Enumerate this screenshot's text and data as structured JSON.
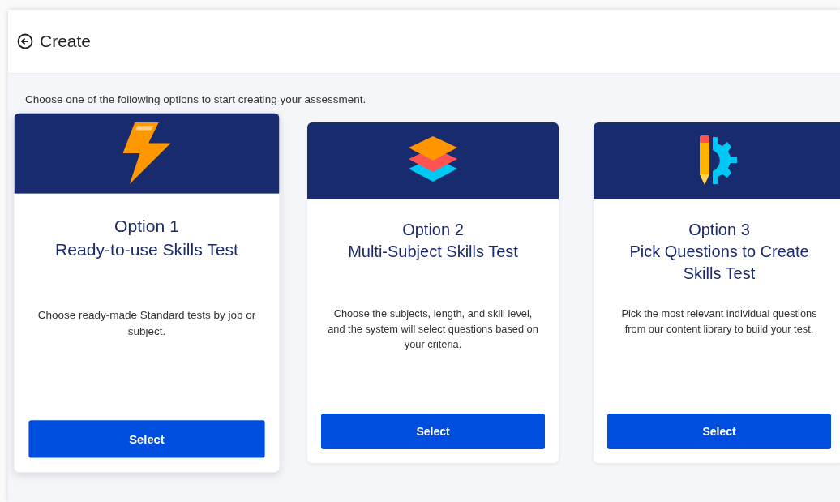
{
  "header": {
    "title": "Create"
  },
  "instruction": "Choose one of the following options to start creating your assessment.",
  "options": [
    {
      "kind": "bolt",
      "hovered": true,
      "option": "Option 1",
      "title": "Ready-to-use Skills Test",
      "description": "Choose ready-made Standard tests by job or subject.",
      "button": "Select"
    },
    {
      "kind": "layers",
      "hovered": false,
      "option": "Option 2",
      "title": "Multi-Subject Skills Test",
      "description": "Choose the subjects, length, and skill level, and the system will select questions based on your criteria.",
      "button": "Select"
    },
    {
      "kind": "pencil-gear",
      "hovered": false,
      "option": "Option 3",
      "title": "Pick Questions to Create Skills Test",
      "description": "Pick the most relevant individual questions from our content library to build your test.",
      "button": "Select"
    }
  ]
}
